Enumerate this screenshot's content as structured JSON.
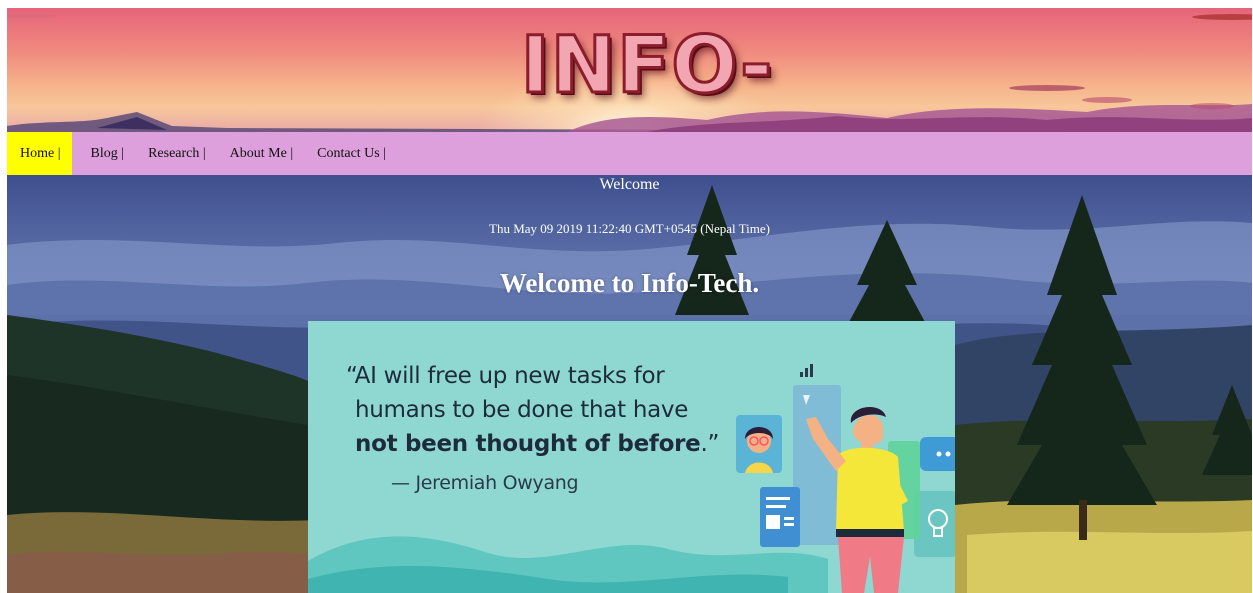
{
  "site": {
    "logo_text": "INFO-TECH.COM"
  },
  "nav": {
    "items": [
      {
        "label": "Home |",
        "active": true
      },
      {
        "label": "Blog |",
        "active": false
      },
      {
        "label": "Research |",
        "active": false
      },
      {
        "label": "About Me |",
        "active": false
      },
      {
        "label": "Contact Us |",
        "active": false
      }
    ],
    "active_color": "#ffff00",
    "bar_color": "#dda0dd"
  },
  "main": {
    "welcome_label": "Welcome",
    "clock": "Thu May 09 2019 11:22:40 GMT+0545 (Nepal Time)",
    "heading": "Welcome to Info-Tech."
  },
  "quote_card": {
    "line1": "“AI will free up new tasks for",
    "line2": "humans to be done that have",
    "line3_bold": "not been thought of before",
    "line3_tail": ".”",
    "attribution": "— Jeremiah Owyang",
    "background_color": "#8fd8d2"
  },
  "icons": [
    "logo-image",
    "signal-bars-icon",
    "adobe-logo-icon",
    "chat-bubble-icon",
    "lightbulb-icon",
    "document-icon",
    "avatar-icon"
  ]
}
